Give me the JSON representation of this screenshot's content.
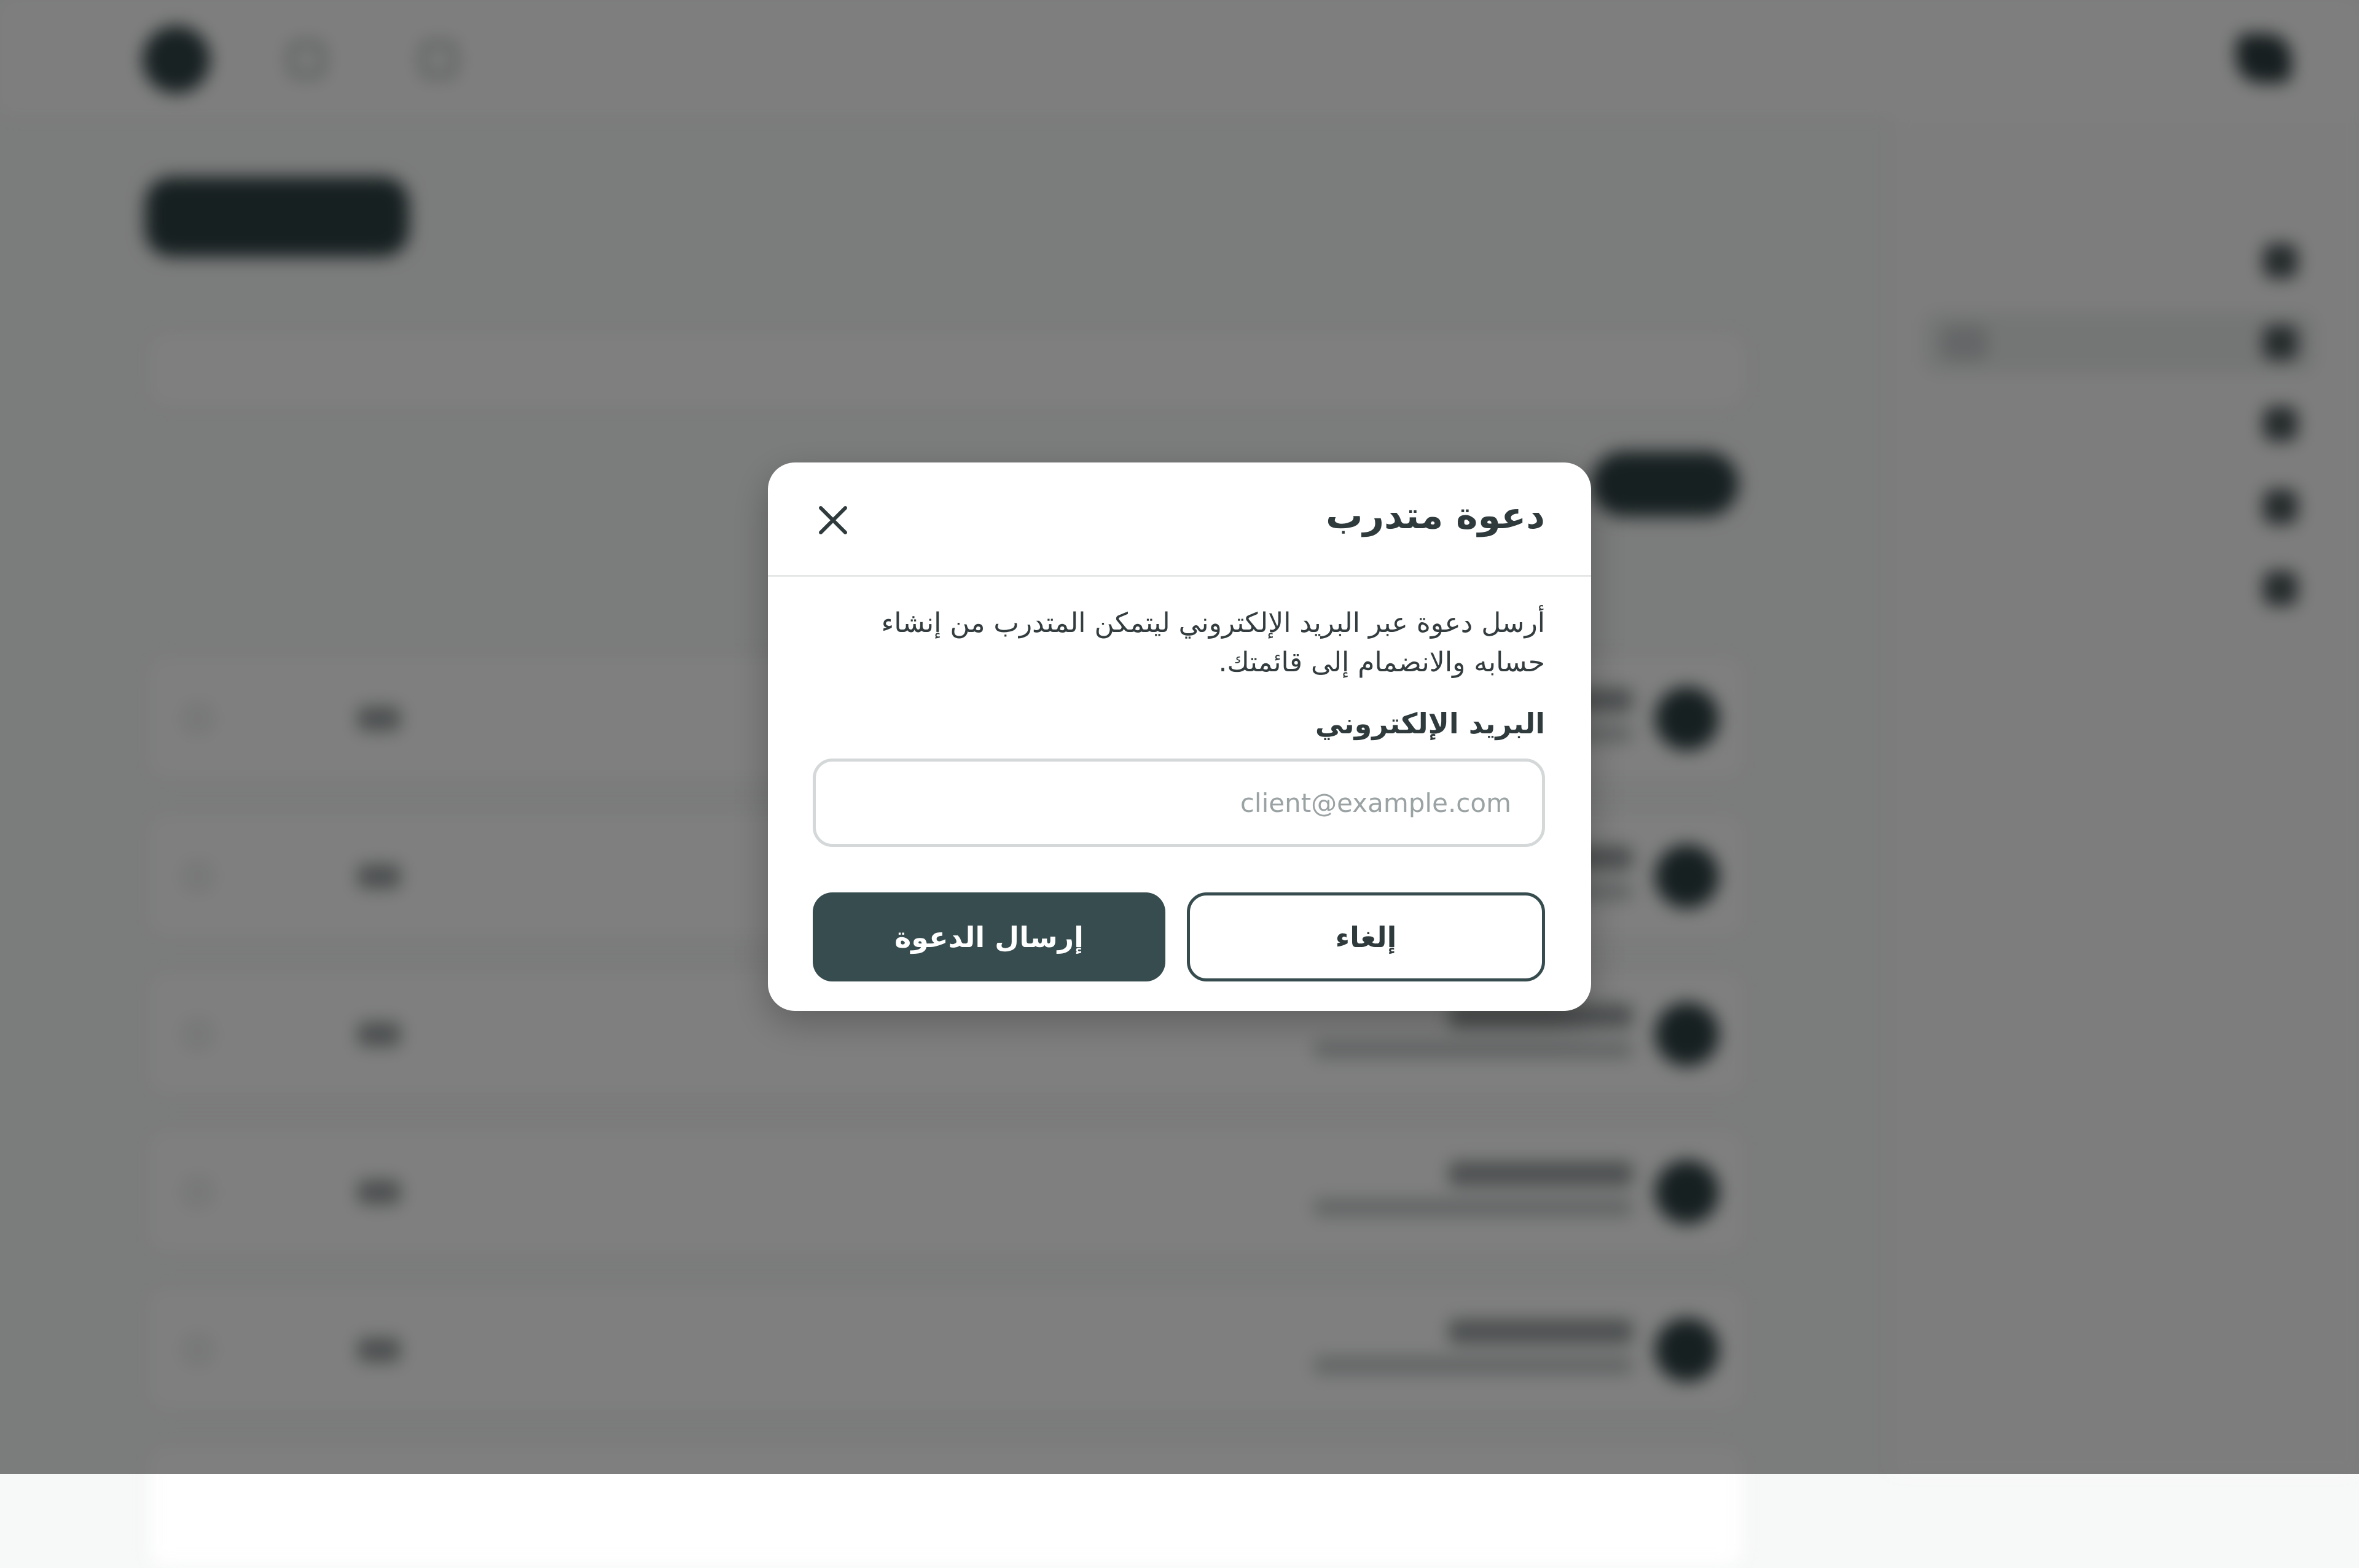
{
  "modal": {
    "title": "دعوة متدرب",
    "description": "أرسل دعوة عبر البريد الإلكتروني ليتمكن المتدرب من إنشاء حسابه والانضمام إلى قائمتك.",
    "email_label": "البريد الإلكتروني",
    "email_placeholder": "client@example.com",
    "email_value": "",
    "send_label": "إرسال الدعوة",
    "cancel_label": "إلغاء",
    "close_icon": "close-icon"
  },
  "colors": {
    "primary": "#374c4e",
    "overlay": "rgba(0,0,0,0.5)",
    "input_border": "#d4d8d9"
  }
}
